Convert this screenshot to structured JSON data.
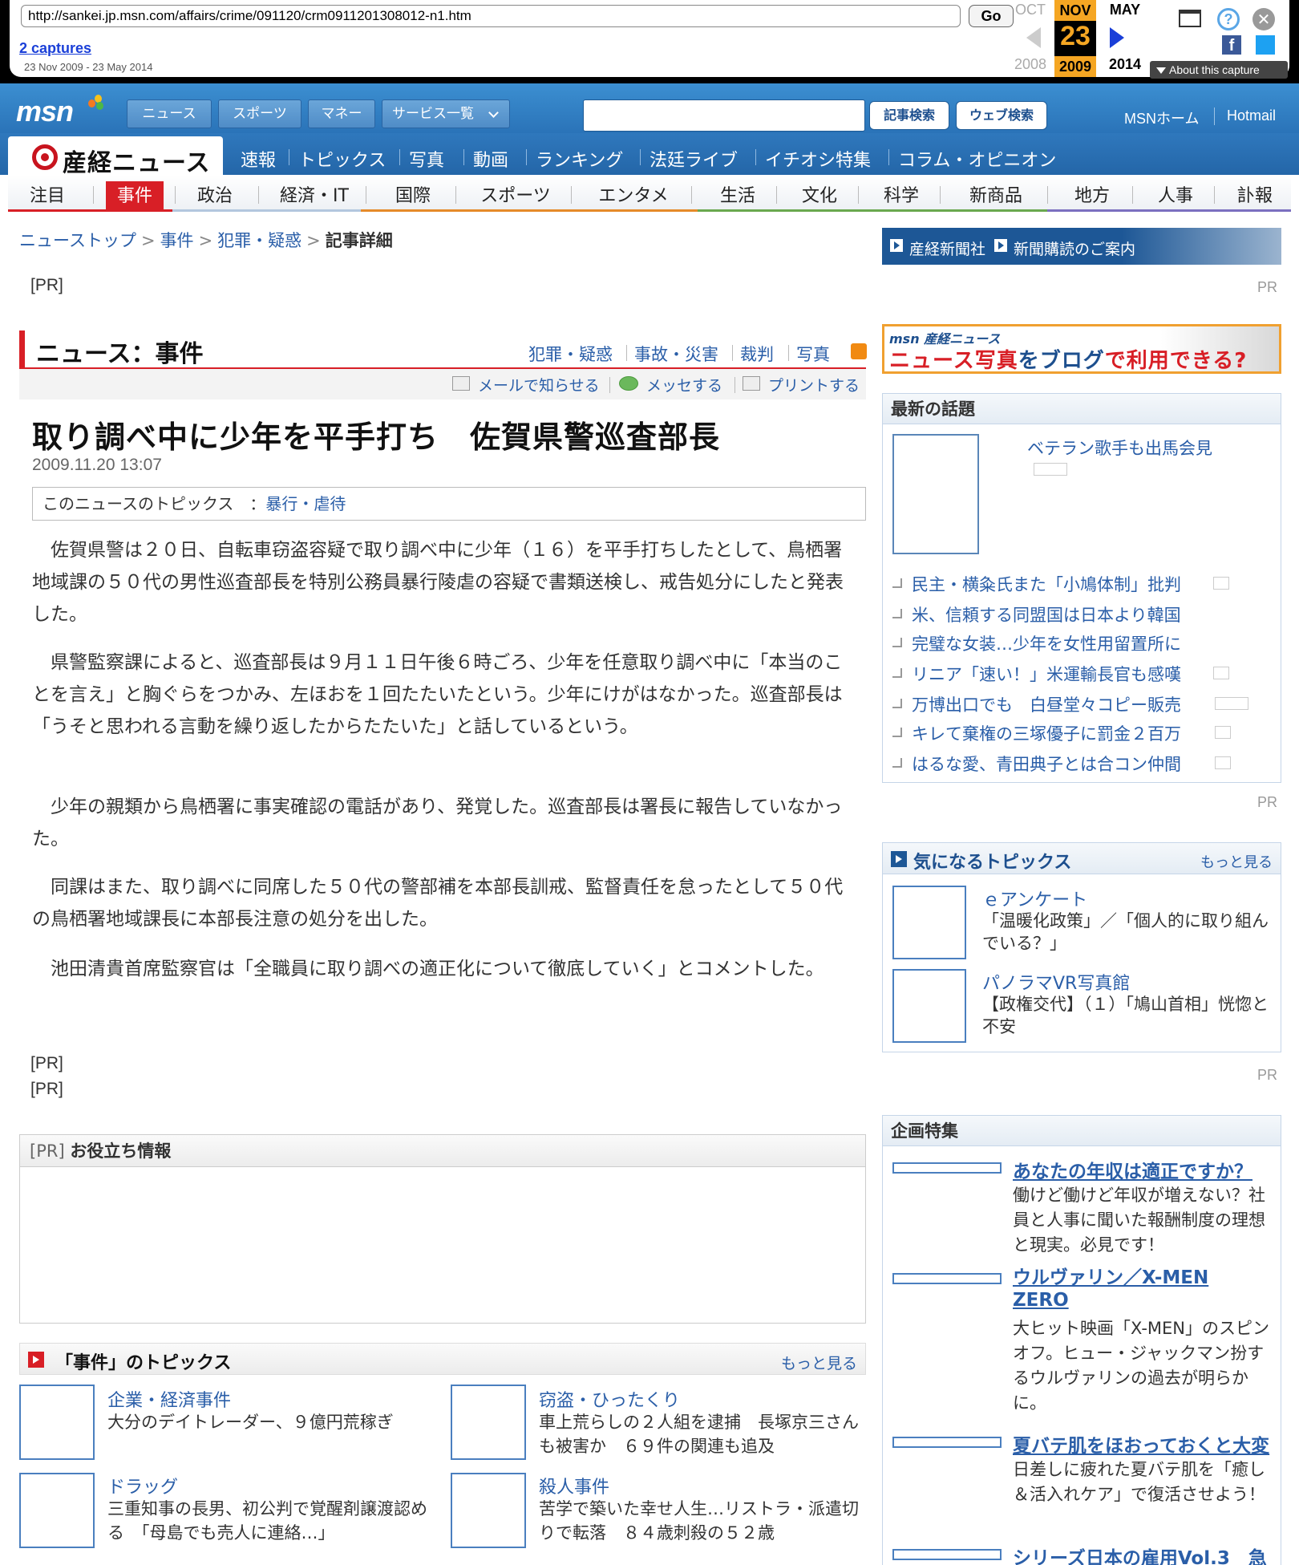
{
  "wayback": {
    "url": "http://sankei.jp.msn.com/affairs/crime/091120/crm0911201308012-n1.htm",
    "go_label": "Go",
    "captures_label": "2 captures",
    "captures_range": "23 Nov 2009 - 23 May 2014",
    "prev_month": "OCT",
    "cur_month": "NOV",
    "next_month": "MAY",
    "cur_day": "23",
    "prev_year": "2008",
    "cur_year": "2009",
    "next_year": "2014",
    "about_label": "About this capture",
    "colors": {
      "highlight": "#f5a623",
      "arrow_active": "#1a3fd8",
      "facebook": "#3b5998",
      "twitter": "#1da1f2"
    }
  },
  "msn": {
    "logo": "msn",
    "tabs": [
      "ニュース",
      "スポーツ",
      "マネー",
      "サービス一覧"
    ],
    "search_btn": "記事検索",
    "web_btn": "ウェブ検索",
    "home_link": "MSNホーム",
    "hotmail_link": "Hotmail"
  },
  "sankei": {
    "logo_text": "産経ニュース",
    "nav": [
      "速報",
      "トピックス",
      "写真",
      "動画",
      "ランキング",
      "法廷ライブ",
      "イチオシ特集",
      "コラム・オピニオン"
    ]
  },
  "categories": [
    "注目",
    "事件",
    "政治",
    "経済・IT",
    "国際",
    "スポーツ",
    "エンタメ",
    "生活",
    "文化",
    "科学",
    "新商品",
    "地方",
    "人事",
    "訃報"
  ],
  "breadcrumb": {
    "top": "ニューストップ",
    "cat": "事件",
    "sub": "犯罪・疑惑",
    "current": "記事詳細",
    "sep": ">"
  },
  "pr_label": "[PR]",
  "pr_small": "PR",
  "section": {
    "title": "ニュース：事件",
    "links": [
      "犯罪・疑惑",
      "事故・災害",
      "裁判",
      "写真"
    ],
    "tools": [
      "メールで知らせる",
      "メッセする",
      "プリントする"
    ]
  },
  "article": {
    "title": "取り調べ中に少年を平手打ち　佐賀県警巡査部長",
    "date": "2009.11.20 13:07",
    "topics_label": "このニュースのトピックス　：",
    "topics_link": "暴行・虐待",
    "paragraphs": [
      "佐賀県警は２０日、自転車窃盗容疑で取り調べ中に少年（１６）を平手打ちしたとして、鳥栖署地域課の５０代の男性巡査部長を特別公務員暴行陵虐の容疑で書類送検し、戒告処分にしたと発表した。",
      "県警監察課によると、巡査部長は９月１１日午後６時ごろ、少年を任意取り調べ中に「本当のことを言え」と胸ぐらをつかみ、左ほおを１回たたいたという。少年にけがはなかった。巡査部長は「うそと思われる言動を繰り返したからたたいた」と話しているという。",
      "少年の親類から鳥栖署に事実確認の電話があり、発覚した。巡査部長は署長に報告していなかった。",
      "同課はまた、取り調べに同席した５０代の警部補を本部長訓戒、監督責任を怠ったとして５０代の鳥栖署地域課長に本部長注意の処分を出した。",
      "池田清貴首席監察官は「全職員に取り調べの適正化について徹底していく」とコメントした。"
    ]
  },
  "oyaku": {
    "pr": "[PR]",
    "title": "お役立ち情報"
  },
  "jiken_topics": {
    "title": "「事件」のトピックス",
    "more": "もっと見る",
    "items": [
      {
        "cat": "企業・経済事件",
        "text": "大分のデイトレーダー、９億円荒稼ぎ"
      },
      {
        "cat": "窃盗・ひったくり",
        "text": "車上荒らしの２人組を逮捕　長塚京三さんも被害か　６９件の関連も追及"
      },
      {
        "cat": "ドラッグ",
        "text": "三重知事の長男、初公判で覚醒剤譲渡認める　「母島でも売人に連絡…」"
      },
      {
        "cat": "殺人事件",
        "text": "苦学で築いた幸せ人生…リストラ・派遣切りで転落　８４歳刺殺の５２歳"
      }
    ]
  },
  "right": {
    "banner1": [
      "産経新聞社",
      "新聞購読のご案内"
    ],
    "banner2_top": "msn 産経ニュース",
    "banner2_main_a": "ニュース写真",
    "banner2_main_b": "を",
    "banner2_main_c": "ブログ",
    "banner2_main_d": "で利用できる?",
    "latest": {
      "title": "最新の話題",
      "featured": "ベテラン歌手も出馬会見",
      "items": [
        "民主・横粂氏また「小鳩体制」批判",
        "米、信頼する同盟国は日本より韓国",
        "完璧な女装…少年を女性用留置所に",
        "リニア「速い！」米運輸長官も感嘆",
        "万博出口でも　白昼堂々コピー販売",
        "キレて棄権の三塚優子に罰金２百万",
        "はるな愛、青田典子とは合コン仲間"
      ]
    },
    "kini": {
      "title": "気になるトピックス",
      "more": "もっと見る",
      "items": [
        {
          "title": "ｅアンケート",
          "desc": "「温暖化政策」／「個人的に取り組んでいる？」"
        },
        {
          "title": "パノラマVR写真館",
          "desc": "【政権交代】（１）「鳩山首相」恍惚と不安"
        }
      ]
    },
    "kikaku": {
      "title": "企画特集",
      "items": [
        {
          "title": "あなたの年収は適正ですか？",
          "desc": "働けど働けど年収が増えない？社員と人事に聞いた報酬制度の理想と現実。必見です！"
        },
        {
          "title": "ウルヴァリン／X-MEN ZERO",
          "desc": "大ヒット映画「X-MEN」のスピンオフ。ヒュー・ジャックマン扮するウルヴァリンの過去が明らかに。"
        },
        {
          "title": "夏バテ肌をほおっておくと大変",
          "desc": "日差しに疲れた夏バテ肌を「癒し＆活入れケア」で復活させよう！"
        },
        {
          "title": "シリーズ日本の雇用Vol.3　急",
          "desc": ""
        }
      ]
    }
  }
}
